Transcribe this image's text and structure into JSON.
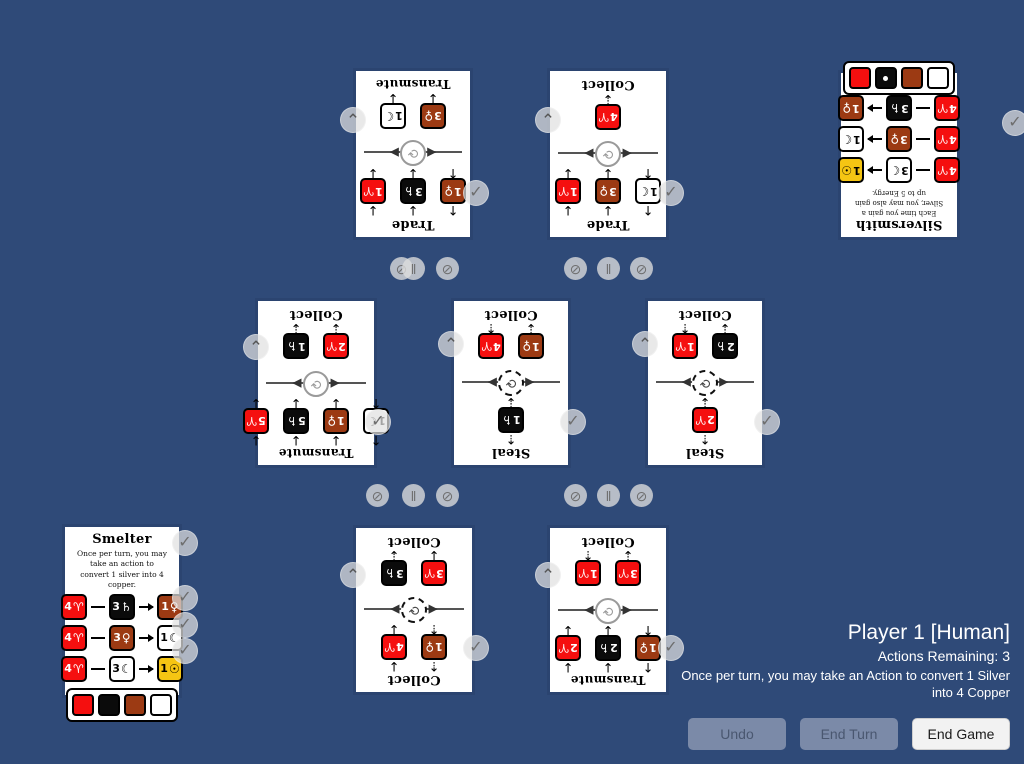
{
  "hud": {
    "player": "Player 1 [Human]",
    "actions": "Actions Remaining: 3",
    "hint": "Once per turn, you may take an Action to convert 1 Silver into 4 Copper",
    "buttons": {
      "undo": "Undo",
      "end_turn": "End Turn",
      "end_game": "End Game"
    }
  },
  "icons": {
    "chevron_up": "⌃",
    "check": "✓",
    "recycle": "⟳",
    "coin_slash": "⊘",
    "coin_pause": "‖",
    "arrow_up": "↑",
    "arrow_down": "↓",
    "arrow_up_dot": "⇡",
    "arrow_down_dot": "⇣",
    "arrow_left": "◀",
    "arrow_right": "▶"
  },
  "symbols": {
    "copper": "♀",
    "silver": "☾",
    "gold": "☉",
    "lead": "♄",
    "energy": "♈"
  },
  "colors": {
    "background": "#2f4a78",
    "card_border": "#2b4470",
    "red": "#f50f0f",
    "black": "#0b0b0b",
    "copper": "#9c3a13",
    "white": "#ffffff",
    "gold": "#f5c513"
  },
  "cards": [
    {
      "id": "top-trade-transmute",
      "flipped": true,
      "top_label": "Trade",
      "bottom_label": "Transmute",
      "top_tokens": [
        {
          "num": "1",
          "sym": "♀",
          "color": "copper",
          "arrow_in": "up",
          "arrow_out": "up"
        },
        {
          "num": "3",
          "sym": "♄",
          "color": "black",
          "arrow_in": "down",
          "arrow_out": "down"
        },
        {
          "num": "1",
          "sym": "♈",
          "color": "red",
          "arrow_in": "down",
          "arrow_out": "down"
        }
      ],
      "bottom_tokens": [
        {
          "num": "3",
          "sym": "♀",
          "color": "copper",
          "arrow_out": "down"
        },
        {
          "num": "1",
          "sym": "☾",
          "color": "white",
          "arrow_out": "down"
        }
      ]
    },
    {
      "id": "top-trade-collect",
      "flipped": true,
      "top_label": "Trade",
      "bottom_label": "Collect",
      "top_tokens": [
        {
          "num": "1",
          "sym": "☾",
          "color": "white",
          "arrow_in": "up",
          "arrow_out": "up"
        },
        {
          "num": "3",
          "sym": "♀",
          "color": "copper",
          "arrow_in": "down",
          "arrow_out": "down"
        },
        {
          "num": "1",
          "sym": "♈",
          "color": "red",
          "arrow_in": "down",
          "arrow_out": "down"
        }
      ],
      "bottom_tokens": [
        {
          "num": "4",
          "sym": "♈",
          "color": "red",
          "arrow_out": "down-dot"
        }
      ]
    },
    {
      "id": "mid-transmute-collect",
      "flipped": true,
      "top_label": "Transmute",
      "bottom_label": "Collect",
      "top_tokens": [
        {
          "num": "1",
          "sym": "☾",
          "color": "white",
          "arrow_in": "up",
          "arrow_out": "up"
        },
        {
          "num": "1",
          "sym": "♀",
          "color": "copper",
          "arrow_in": "down",
          "arrow_out": "down"
        },
        {
          "num": "5",
          "sym": "♄",
          "color": "black",
          "arrow_in": "down",
          "arrow_out": "down"
        },
        {
          "num": "5",
          "sym": "♈",
          "color": "red",
          "arrow_in": "down",
          "arrow_out": "down"
        }
      ],
      "bottom_tokens": [
        {
          "num": "2",
          "sym": "♈",
          "color": "red",
          "arrow_out": "down-dot"
        },
        {
          "num": "1",
          "sym": "♄",
          "color": "black",
          "arrow_out": "down-dot"
        }
      ]
    },
    {
      "id": "mid-steal-collect-a",
      "flipped": true,
      "top_label": "Steal",
      "bottom_label": "Collect",
      "top_tokens": [
        {
          "num": "1",
          "sym": "♄",
          "color": "black",
          "arrow_in": "up-dot",
          "arrow_out": "down-dot"
        }
      ],
      "bottom_tokens": [
        {
          "num": "1",
          "sym": "♀",
          "color": "copper",
          "arrow_out": "down-dot"
        },
        {
          "num": "4",
          "sym": "♈",
          "color": "red",
          "arrow_out": "up-dot"
        }
      ]
    },
    {
      "id": "mid-steal-collect-b",
      "flipped": true,
      "top_label": "Steal",
      "bottom_label": "Collect",
      "top_tokens": [
        {
          "num": "2",
          "sym": "♈",
          "color": "red",
          "arrow_in": "up-dot",
          "arrow_out": "down-dot"
        }
      ],
      "bottom_tokens": [
        {
          "num": "2",
          "sym": "♄",
          "color": "black",
          "arrow_out": "down-dot"
        },
        {
          "num": "1",
          "sym": "♈",
          "color": "red",
          "arrow_out": "up-dot"
        }
      ]
    },
    {
      "id": "bot-collect-collect",
      "flipped": true,
      "top_label": "Collect",
      "bottom_label": "Collect",
      "top_tokens": [
        {
          "num": "1",
          "sym": "♀",
          "color": "copper",
          "arrow_in": "up-dot",
          "arrow_out": "up-dot"
        },
        {
          "num": "4",
          "sym": "♈",
          "color": "red",
          "arrow_in": "down",
          "arrow_out": "down"
        }
      ],
      "bottom_tokens": [
        {
          "num": "3",
          "sym": "♈",
          "color": "red",
          "arrow_out": "down"
        },
        {
          "num": "3",
          "sym": "♄",
          "color": "black",
          "arrow_out": "down-dot"
        }
      ]
    },
    {
      "id": "bot-transmute-collect",
      "flipped": true,
      "top_label": "Transmute",
      "bottom_label": "Collect",
      "top_tokens": [
        {
          "num": "1",
          "sym": "♀",
          "color": "copper",
          "arrow_in": "up",
          "arrow_out": "up"
        },
        {
          "num": "2",
          "sym": "♄",
          "color": "black",
          "arrow_in": "down",
          "arrow_out": "down"
        },
        {
          "num": "2",
          "sym": "♈",
          "color": "red",
          "arrow_in": "down",
          "arrow_out": "down"
        }
      ],
      "bottom_tokens": [
        {
          "num": "3",
          "sym": "♈",
          "color": "red",
          "arrow_out": "down-dot"
        },
        {
          "num": "1",
          "sym": "♈",
          "color": "red",
          "arrow_out": "up-dot"
        }
      ]
    }
  ],
  "smelter": {
    "title": "Smelter",
    "desc": "Once per turn, you may take an action to convert 1 silver into 4 copper.",
    "rows": [
      {
        "from": {
          "num": "4",
          "sym": "♈",
          "color": "red"
        },
        "mid": {
          "num": "3",
          "sym": "♄",
          "color": "black"
        },
        "to": {
          "num": "1",
          "sym": "♀",
          "color": "copper"
        }
      },
      {
        "from": {
          "num": "4",
          "sym": "♈",
          "color": "red"
        },
        "mid": {
          "num": "3",
          "sym": "♀",
          "color": "copper"
        },
        "to": {
          "num": "1",
          "sym": "☾",
          "color": "white"
        }
      },
      {
        "from": {
          "num": "4",
          "sym": "♈",
          "color": "red"
        },
        "mid": {
          "num": "3",
          "sym": "☾",
          "color": "white"
        },
        "to": {
          "num": "1",
          "sym": "☉",
          "color": "gold"
        }
      }
    ],
    "palette": [
      "#f50f0f",
      "#0b0b0b",
      "#9c3a13",
      "#ffffff"
    ]
  },
  "silversmith": {
    "title": "Silversmith",
    "desc": "Each time you gain a Silver, you may also gain up to 5 Energy.",
    "palette": [
      "#ffffff",
      "#9c3a13",
      "#0b0b0b",
      "#f50f0f"
    ],
    "palette_dot_index": 2,
    "rows": [
      {
        "from": {
          "num": "4",
          "sym": "♈",
          "color": "red"
        },
        "mid": {
          "num": "3",
          "sym": "☾",
          "color": "white"
        },
        "to": {
          "num": "1",
          "sym": "☉",
          "color": "gold"
        }
      },
      {
        "from": {
          "num": "4",
          "sym": "♈",
          "color": "red"
        },
        "mid": {
          "num": "3",
          "sym": "♀",
          "color": "copper"
        },
        "to": {
          "num": "1",
          "sym": "☾",
          "color": "white"
        }
      },
      {
        "from": {
          "num": "4",
          "sym": "♈",
          "color": "red"
        },
        "mid": {
          "num": "3",
          "sym": "♄",
          "color": "black"
        },
        "to": {
          "num": "1",
          "sym": "♀",
          "color": "copper"
        }
      }
    ]
  }
}
